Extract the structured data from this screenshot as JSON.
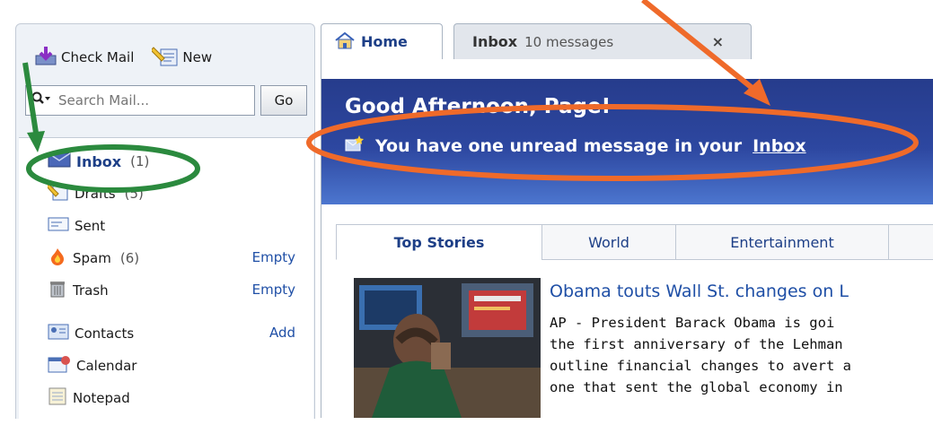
{
  "toolbar": {
    "check_mail": "Check Mail",
    "new": "New"
  },
  "search": {
    "placeholder": "Search Mail...",
    "go": "Go"
  },
  "folders": [
    {
      "name": "Inbox",
      "count": "(1)",
      "icon": "inbox-icon"
    },
    {
      "name": "Drafts",
      "count": "(5)",
      "icon": "drafts-icon"
    },
    {
      "name": "Sent",
      "count": "",
      "icon": "sent-icon"
    },
    {
      "name": "Spam",
      "count": "(6)",
      "action": "Empty",
      "icon": "spam-icon"
    },
    {
      "name": "Trash",
      "count": "",
      "action": "Empty",
      "icon": "trash-icon"
    }
  ],
  "tools": [
    {
      "name": "Contacts",
      "action": "Add",
      "icon": "contacts-icon"
    },
    {
      "name": "Calendar",
      "icon": "calendar-icon"
    },
    {
      "name": "Notepad",
      "icon": "notepad-icon"
    }
  ],
  "tabs": {
    "home": "Home",
    "inbox": "Inbox",
    "inbox_sub": "10 messages",
    "close": "×"
  },
  "banner": {
    "greeting": "Good Afternoon, Page!",
    "notice": "You have one unread message in your",
    "notice_link": "Inbox"
  },
  "stories": {
    "tabs": [
      "Top Stories",
      "World",
      "Entertainment",
      ""
    ],
    "headline": "Obama touts Wall St. changes on L",
    "body": [
      "AP - President Barack Obama is goi",
      "the first anniversary of the Lehman",
      "outline financial changes to avert a",
      "one that sent the global economy in"
    ]
  },
  "colors": {
    "banner": "#263c8c",
    "link": "#1f4fa6",
    "annotation_green": "#2b8a3e",
    "annotation_orange": "#ef6a2a"
  }
}
